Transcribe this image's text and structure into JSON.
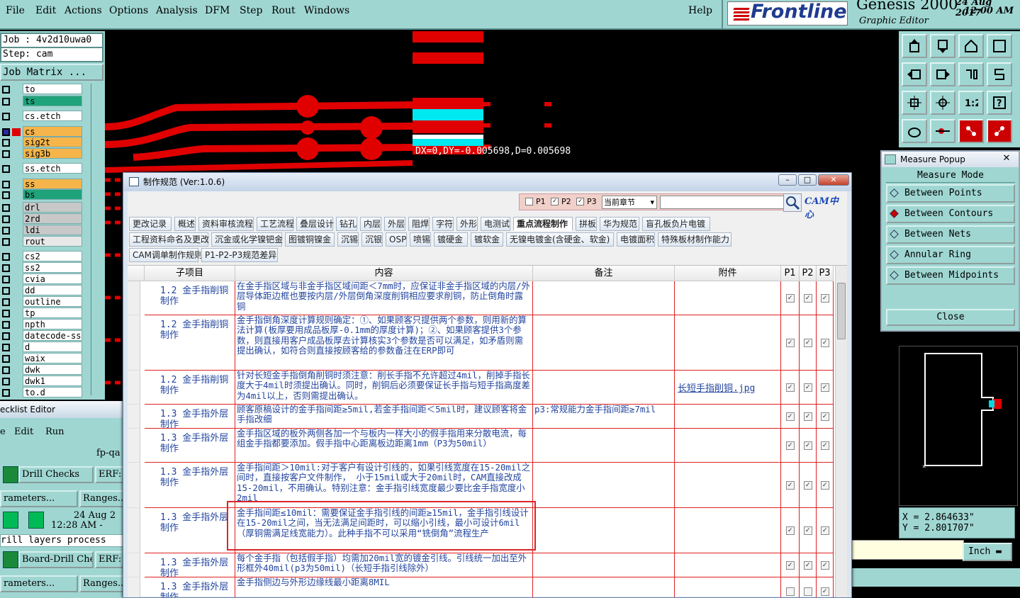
{
  "menubar": {
    "items": [
      "File",
      "Edit",
      "Actions",
      "Options",
      "Analysis",
      "DFM",
      "Step",
      "Rout",
      "Windows"
    ],
    "help": "Help"
  },
  "brand": {
    "logo": "Frontline",
    "product": "Genesis 2000",
    "subtitle": "Graphic Editor",
    "date": "24 Aug 2017",
    "time": "12:00 AM"
  },
  "leftpanel": {
    "job": "Job : 4v2d10uwa0",
    "step": "Step: cam",
    "job_matrix": "Job Matrix ...",
    "layers": [
      {
        "name": "to",
        "color": "#ffffff"
      },
      {
        "name": "ts",
        "color": "#1fa37a"
      },
      {
        "name": "cs.etch",
        "color": "#ffffff"
      },
      {
        "name": "cs",
        "color": "#f5b54a"
      },
      {
        "name": "sig2t",
        "color": "#f5b54a"
      },
      {
        "name": "sig3b",
        "color": "#f5b54a"
      },
      {
        "name": "ss.etch",
        "color": "#ffffff"
      },
      {
        "name": "ss",
        "color": "#f5b54a"
      },
      {
        "name": "bs",
        "color": "#1fa37a"
      },
      {
        "name": "drl",
        "color": "#c8c8c8"
      },
      {
        "name": "2rd",
        "color": "#c8c8c8"
      },
      {
        "name": "ldi",
        "color": "#c8c8c8"
      },
      {
        "name": "rout",
        "color": "#e8e8e8"
      },
      {
        "name": "cs2",
        "color": "#ffffff"
      },
      {
        "name": "ss2",
        "color": "#ffffff"
      },
      {
        "name": "cvia",
        "color": "#ffffff"
      },
      {
        "name": "dd",
        "color": "#ffffff"
      },
      {
        "name": "outline",
        "color": "#ffffff"
      },
      {
        "name": "tp",
        "color": "#ffffff"
      },
      {
        "name": "npth",
        "color": "#ffffff"
      },
      {
        "name": "datecode-ss",
        "color": "#ffffff"
      },
      {
        "name": "d",
        "color": "#ffffff"
      },
      {
        "name": "waix",
        "color": "#ffffff"
      },
      {
        "name": "dwk",
        "color": "#ffffff"
      },
      {
        "name": "dwk1",
        "color": "#ffffff"
      },
      {
        "name": "to.d",
        "color": "#ffffff"
      }
    ]
  },
  "checklist": {
    "title": "ecklist Editor",
    "menu_edit": "Edit",
    "menu_run": "Run",
    "menu_e": "e",
    "fp": "fp-qa",
    "drill_checks": "Drill Checks",
    "erf1": "ERF:",
    "parameters1": "rameters...",
    "ranges1": "Ranges...",
    "date": "24 Aug 2",
    "time": "12:28 AM -",
    "status": "rill layers process",
    "board_drill": "Board-Drill Che",
    "erf2": "ERF:",
    "parameters2": "rameters...",
    "ranges2": "Ranges..."
  },
  "canvas": {
    "measure_text": "DX=0,DY=-0.005698,D=0.005698"
  },
  "measure_popup": {
    "title": "Measure Popup",
    "header": "Measure Mode",
    "options": [
      {
        "label": "Between Points",
        "selected": false
      },
      {
        "label": "Between Contours",
        "selected": true
      },
      {
        "label": "Between Nets",
        "selected": false
      },
      {
        "label": "Annular Ring",
        "selected": false
      },
      {
        "label": "Between Midpoints",
        "selected": false
      }
    ],
    "close": "Close"
  },
  "coords": {
    "x": "X = 2.864633\"",
    "y": "Y = 2.801707\""
  },
  "units": "Inch",
  "dialog": {
    "title": "制作规范 (Ver:1.0.6)",
    "filter": {
      "p1": "P1",
      "p2": "P2",
      "p3": "P3",
      "scope": "当前章节",
      "search_placeholder": ""
    },
    "cam_center": "CAM中心",
    "tabs_row1": [
      "更改记录",
      "概述",
      "资料审核流程",
      "工艺流程",
      "叠层设计",
      "钻孔",
      "内层",
      "外层",
      "阻焊",
      "字符",
      "外形",
      "电测试",
      "重点流程制作",
      "拼板",
      "华为规范",
      "盲孔板负片电镀"
    ],
    "tabs_row2": [
      "工程资料命名及更改",
      "沉金或化学镍钯金",
      "图镀铜镍金",
      "沉锡",
      "沉银",
      "OSP",
      "喷锡",
      "镀硬金",
      "镀软金",
      "无镍电镀金(含硬金、软金)",
      "电镀面积",
      "特殊板材制作能力"
    ],
    "tabs_row3": [
      "CAM调单制作规则",
      "P1-P2-P3规范差异"
    ],
    "active_tab": "重点流程制作",
    "columns": [
      "子项目",
      "内容",
      "备注",
      "附件",
      "P1",
      "P2",
      "P3"
    ],
    "rows": [
      {
        "sub": "1.2 金手指削铜制作",
        "content": "在金手指区域与非金手指区域间距＜7mm时，应保证非金手指区域的内层/外层导体距边框也要按内层/外层倒角深度削铜相应要求削铜，防止倒角时露铜",
        "note": "",
        "attach": "",
        "p": [
          true,
          true,
          true
        ]
      },
      {
        "sub": "1.2 金手指削铜制作",
        "content": "金手指倒角深度计算规则确定：①、如果顾客只提供两个参数，则用新的算法计算(板厚要用成品板厚-0.1mm的厚度计算)；②、如果顾客提供3个参数，则直接用客户成品板厚去计算核实3个参数是否可以满足，如矛盾则需提出确认，如符合则直接按顾客给的参数备注在ERP即可",
        "note": "",
        "attach": "",
        "p": [
          true,
          true,
          true
        ]
      },
      {
        "sub": "1.2 金手指削铜制作",
        "content": "针对长短金手指倒角削铜时须注意：削长手指不允许超过4mil，削掉手指长度大于4mil时须提出确认。同时，削铜后必须要保证长手指与短手指高度差为4mil以上，否则需提出确认。",
        "note": "",
        "attach": "长短手指削铜.jpg",
        "p": [
          true,
          true,
          true
        ]
      },
      {
        "sub": "1.3 金手指外层制作",
        "content": "顾客原稿设计的金手指间距≥5mil,若金手指间距＜5mil时，建议顾客将金手指改细",
        "note": "p3:常规能力金手指间距≥7mil",
        "attach": "",
        "p": [
          true,
          true,
          true
        ]
      },
      {
        "sub": "1.3 金手指外层制作",
        "content": "金手指区域的板外两侧各加一个与板内一样大小的假手指用来分散电流，每组金手指都要添加。假手指中心距离板边距离1mm（P3为50mil）",
        "note": "",
        "attach": "",
        "p": [
          true,
          true,
          true
        ]
      },
      {
        "sub": "1.3 金手指外层制作",
        "content": "金手指间距＞10mil:对于客户有设计引线的，如果引线宽度在15-20mil之间时，直接按客户文件制作， 小于15mil或大于20mil时，CAM直接改成15-20mil，不用确认。特别注意：金手指引线宽度最少要比金手指宽度小2mil",
        "note": "",
        "attach": "",
        "p": [
          true,
          true,
          true
        ]
      },
      {
        "sub": "1.3 金手指外层制作",
        "content": "金手指间距≤10mil：需要保证金手指引线的间距≥15mil，金手指引线设计在15-20mil之间，当无法满足间距时，可以缩小引线，最小可设计6mil（厚铜需满足线宽能力）。此种手指不可以采用“铣倒角”流程生产",
        "note": "",
        "attach": "",
        "p": [
          true,
          true,
          true
        ]
      },
      {
        "sub": "1.3 金手指外层制作",
        "content": "每个金手指（包括假手指）均需加20mil宽的镀金引线。引线统一加出至外形框外40mil(p3为50mil)（长短手指引线除外）",
        "note": "",
        "attach": "",
        "p": [
          true,
          true,
          true
        ]
      },
      {
        "sub": "1.3 金手指外层制作",
        "content": "金手指侧边与外形边缘线最小距离8MIL",
        "note": "",
        "attach": "",
        "p": [
          false,
          false,
          true
        ]
      }
    ]
  }
}
